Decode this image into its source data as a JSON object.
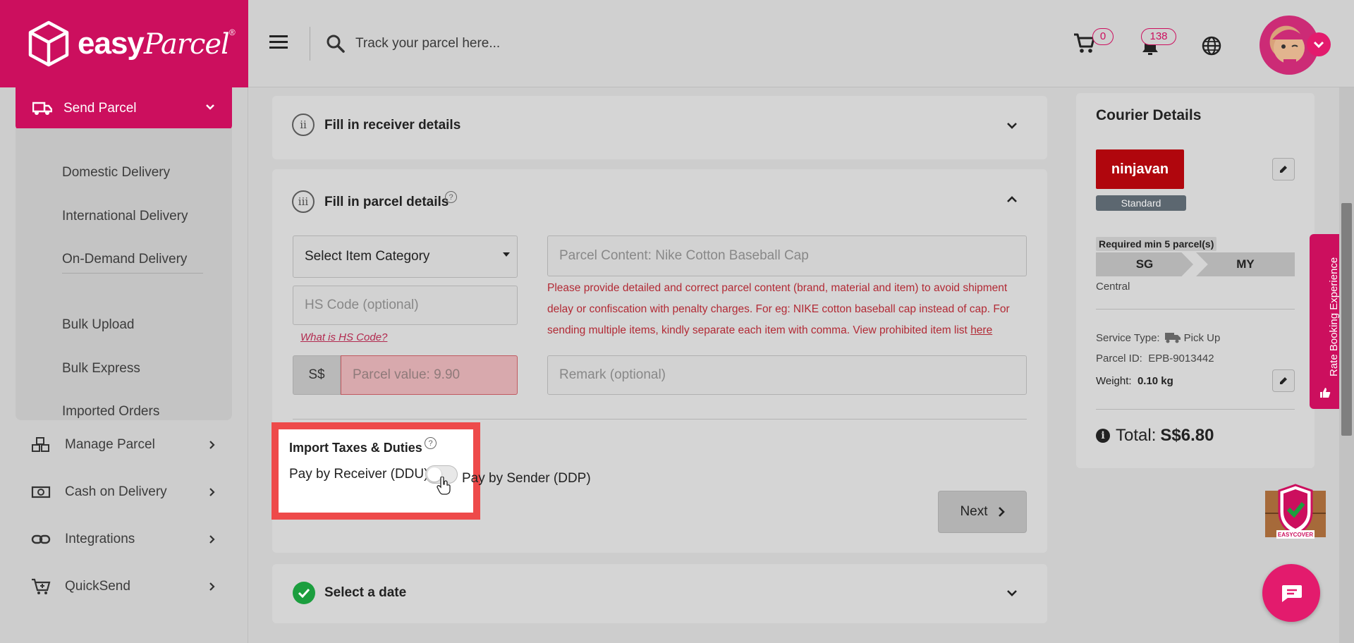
{
  "header": {
    "logo_text_bold": "easy",
    "logo_text_script": "Parcel",
    "logo_reg": "®",
    "search_placeholder": "Track your parcel here...",
    "cart_count": "0",
    "notification_count": "138",
    "brand_color": "#cc0f5e"
  },
  "sidebar": {
    "send_parcel": "Send Parcel",
    "submenu": [
      "Domestic Delivery",
      "International Delivery",
      "On-Demand Delivery",
      "Bulk Upload",
      "Bulk Express",
      "Imported Orders"
    ],
    "nav": [
      {
        "label": "Manage Parcel",
        "icon": "boxes-icon"
      },
      {
        "label": "Cash on Delivery",
        "icon": "cash-icon"
      },
      {
        "label": "Integrations",
        "icon": "link-icon"
      },
      {
        "label": "QuickSend",
        "icon": "cart-plus-icon"
      }
    ]
  },
  "steps": {
    "receiver": {
      "number": "ii",
      "title": "Fill in receiver details"
    },
    "parcel": {
      "number": "iii",
      "title": "Fill in parcel details"
    },
    "date": {
      "title": "Select a date"
    }
  },
  "parcel_form": {
    "item_category": "Select Item Category",
    "parcel_content_placeholder": "Parcel Content: Nike Cotton Baseball Cap",
    "hs_code_placeholder": "HS Code (optional)",
    "hs_link": "What is HS Code?",
    "currency": "S$",
    "parcel_value_placeholder": "Parcel value: 9.90",
    "remark_placeholder": "Remark (optional)",
    "warning": "Please provide detailed and correct parcel content (brand, material and item) to avoid shipment delay or confiscation with penalty charges. For eg: NIKE cotton baseball cap instead of cap. For sending multiple items, kindly separate each item with comma. View prohibited item list",
    "warning_link": "here",
    "tax_title": "Import Taxes & Duties",
    "ddu_label": "Pay by Receiver (DDU)",
    "ddp_label": "Pay by Sender (DDP)",
    "ddp_selected": false,
    "next_label": "Next"
  },
  "courier": {
    "title": "Courier Details",
    "courier_logo": "ninjavan",
    "service_level": "Standard",
    "min_parcels": "Required min 5 parcel(s)",
    "origin": "SG",
    "destination": "MY",
    "region": "Central",
    "service_type_label": "Service Type:",
    "service_type_value": "Pick Up",
    "parcel_id_label": "Parcel ID:",
    "parcel_id_value": "EPB-9013442",
    "weight_label": "Weight:",
    "weight_value": "0.10 kg",
    "total_label": "Total:",
    "total_value": "S$6.80"
  },
  "rate_tab": "Rate Booking Experience",
  "easycover_label": "EASYCOVER"
}
